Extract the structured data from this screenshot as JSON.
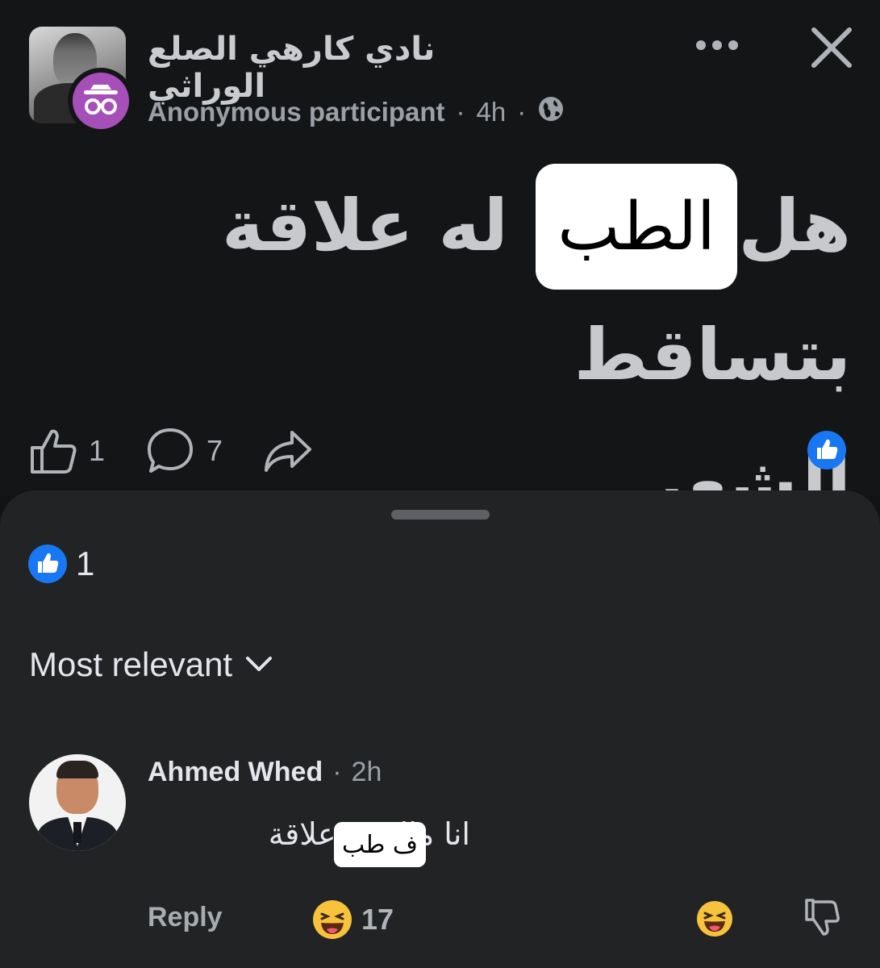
{
  "post": {
    "group_name": "نادي كارهي الصلع الوراثي",
    "author": "Anonymous participant",
    "separator": "·",
    "time": "4h",
    "text_line1": "هل الـ ... له علاقة بتساقط",
    "text_line2": "الشعر",
    "overlay_label": "الطب",
    "likes": "1",
    "comments": "7",
    "icons": {
      "anon": "incognito-icon",
      "more": "more-dots-icon",
      "close": "close-icon",
      "privacy": "globe-icon",
      "like": "thumbs-up-icon",
      "comment": "comment-bubble-icon",
      "share": "share-arrow-icon"
    }
  },
  "sheet": {
    "reaction_count": "1",
    "sort_label": "Most relevant"
  },
  "comment": {
    "author": "Ahmed Whed",
    "separator": "·",
    "time": "2h",
    "text": "انا           مالوش علاقة",
    "sticker": "ف طب",
    "reply_label": "Reply",
    "reaction_count": "17"
  },
  "colors": {
    "background": "#141516",
    "sheet": "#212325",
    "accent_blue": "#1877f2",
    "anon_purple": "#a64fb8"
  }
}
